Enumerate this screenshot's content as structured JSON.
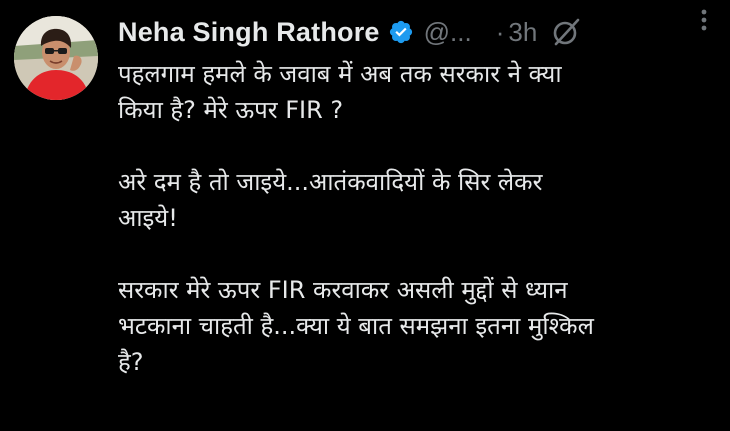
{
  "tweet": {
    "author": {
      "display_name": "Neha Singh Rathore",
      "handle": "@...",
      "verified_icon": "verified-badge-icon",
      "avatar": "user-avatar"
    },
    "separator": "·",
    "time": "3h",
    "grok_icon": "grok-icon",
    "more_icon": "more-options-icon",
    "paragraphs": [
      {
        "line1": "पहलगाम हमले के जवाब में अब तक सरकार ने क्या",
        "line2": "किया है? मेरे ऊपर FIR ?"
      },
      {
        "line1": "अरे दम है तो जाइये...आतंकवादियों के सिर लेकर",
        "line2": "आइये!"
      },
      {
        "line1": "सरकार मेरे ऊपर FIR करवाकर असली मुद्दों से ध्यान",
        "line2": "भटकाना चाहती है...क्या ये बात समझना इतना मुश्किल",
        "line3": "है?"
      }
    ],
    "colors": {
      "background": "#000000",
      "text": "#e7e9ea",
      "muted": "#71767b",
      "verified": "#1d9bf0"
    }
  }
}
